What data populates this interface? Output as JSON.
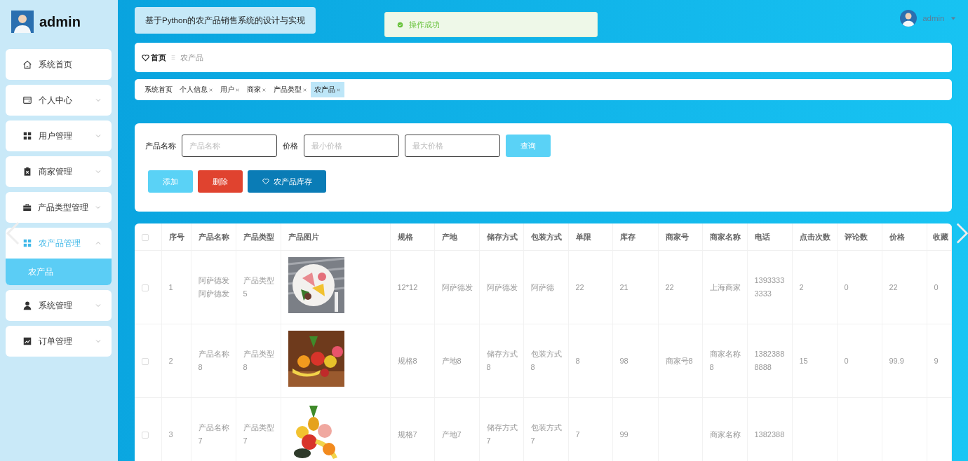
{
  "sidebar": {
    "user": {
      "name": "admin"
    },
    "items": [
      {
        "label": "系统首页",
        "kind": "link",
        "expanded": false
      },
      {
        "label": "个人中心",
        "kind": "menu",
        "expanded": false
      },
      {
        "label": "用户管理",
        "kind": "menu",
        "expanded": false
      },
      {
        "label": "商家管理",
        "kind": "menu",
        "expanded": false
      },
      {
        "label": "产品类型管理",
        "kind": "menu",
        "expanded": false
      },
      {
        "label": "农产品管理",
        "kind": "menu",
        "expanded": true,
        "children": [
          {
            "label": "农产品",
            "selected": true
          }
        ]
      },
      {
        "label": "系统管理",
        "kind": "menu",
        "expanded": false
      },
      {
        "label": "订单管理",
        "kind": "menu",
        "expanded": false
      }
    ]
  },
  "header": {
    "title": "基于Python的农产品销售系统的设计与实现",
    "toast": {
      "text": "操作成功"
    },
    "user": {
      "name": "admin"
    }
  },
  "breadcrumb": [
    {
      "label": "首页"
    },
    {
      "label": "农产品"
    }
  ],
  "tabs": [
    {
      "label": "系统首页",
      "closable": false,
      "selected": false
    },
    {
      "label": "个人信息",
      "closable": true,
      "selected": false
    },
    {
      "label": "用户",
      "closable": true,
      "selected": false
    },
    {
      "label": "商家",
      "closable": true,
      "selected": false
    },
    {
      "label": "产品类型",
      "closable": true,
      "selected": false
    },
    {
      "label": "农产品",
      "closable": true,
      "selected": true
    }
  ],
  "search": {
    "fields": [
      {
        "label": "产品名称",
        "placeholder": "产品名称"
      },
      {
        "label": "价格",
        "placeholder": "最小价格"
      },
      {
        "placeholder": "最大价格"
      }
    ],
    "button": "查询",
    "actions": [
      {
        "label": "添加",
        "kind": "add"
      },
      {
        "label": "删除",
        "kind": "delete"
      },
      {
        "label": "农产品库存",
        "kind": "stock"
      }
    ]
  },
  "table": {
    "header_checked": false,
    "columns": [
      "序号",
      "产品名称",
      "产品类型",
      "产品图片",
      "规格",
      "产地",
      "储存方式",
      "包装方式",
      "单限",
      "库存",
      "商家号",
      "商家名称",
      "电话",
      "点击次数",
      "评论数",
      "价格",
      "收藏"
    ],
    "rows": [
      {
        "checked": false,
        "cells": [
          "1",
          "阿萨德发阿萨德发",
          "产品类型5",
          {
            "kind": "picture"
          },
          "12*12",
          "阿萨德发",
          "阿萨德发",
          "阿萨德",
          "22",
          "21",
          "22",
          "上海商家",
          "13933333333",
          "2",
          "0",
          "22",
          "0"
        ]
      },
      {
        "checked": false,
        "cells": [
          "2",
          "产品名称8",
          "产品类型8",
          {
            "kind": "picture"
          },
          "规格8",
          "产地8",
          "储存方式8",
          "包装方式8",
          "8",
          "98",
          "商家号8",
          "商家名称8",
          "13823888888",
          "15",
          "0",
          "99.9",
          "9"
        ]
      },
      {
        "checked": false,
        "cells": [
          "3",
          "产品名称7",
          "产品类型7",
          {
            "kind": "picture"
          },
          "规格7",
          "产地7",
          "储存方式7",
          "包装方式7",
          "7",
          "99",
          null,
          "商家名称",
          "1382388",
          null,
          null,
          null,
          null
        ]
      }
    ]
  }
}
